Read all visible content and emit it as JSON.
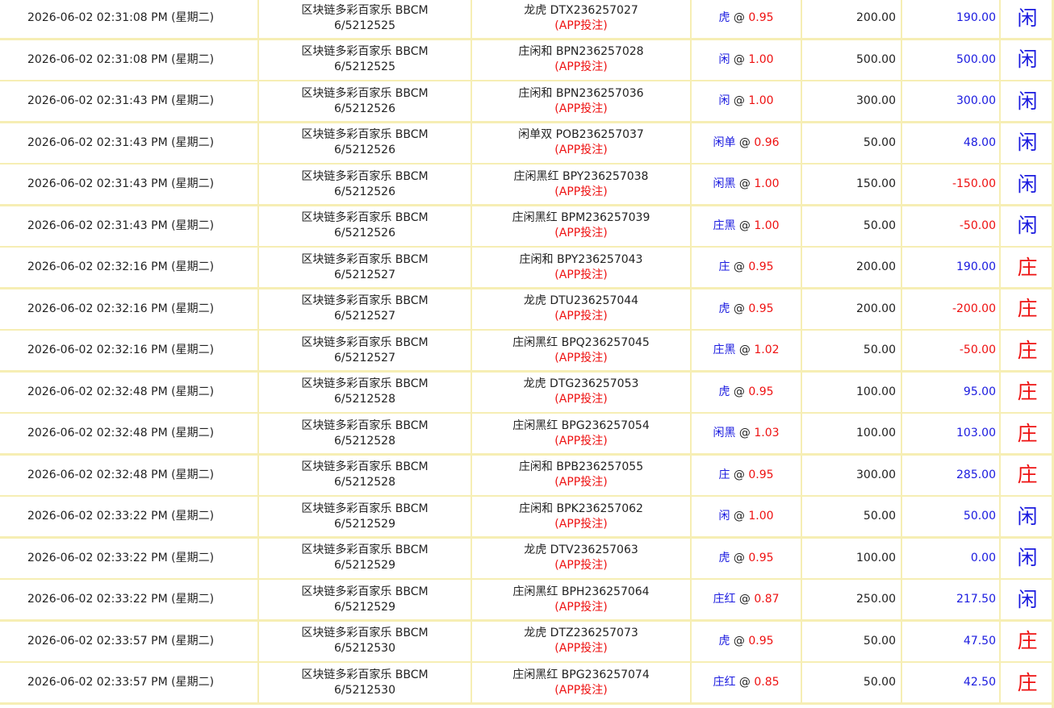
{
  "rows": [
    {
      "time": "2026-06-02 02:31:08 PM (星期二)",
      "game": "区块链多彩百家乐 BBCM",
      "round": "6/5212525",
      "bet_type": "龙虎 DTX236257027",
      "source": "(APP投注)",
      "pick": "虎",
      "odds": "0.95",
      "amount": "200.00",
      "win": "190.00",
      "win_color": "blue",
      "result": "闲",
      "result_color": "blue"
    },
    {
      "time": "2026-06-02 02:31:08 PM (星期二)",
      "game": "区块链多彩百家乐 BBCM",
      "round": "6/5212525",
      "bet_type": "庄闲和 BPN236257028",
      "source": "(APP投注)",
      "pick": "闲",
      "odds": "1.00",
      "amount": "500.00",
      "win": "500.00",
      "win_color": "blue",
      "result": "闲",
      "result_color": "blue"
    },
    {
      "time": "2026-06-02 02:31:43 PM (星期二)",
      "game": "区块链多彩百家乐 BBCM",
      "round": "6/5212526",
      "bet_type": "庄闲和 BPN236257036",
      "source": "(APP投注)",
      "pick": "闲",
      "odds": "1.00",
      "amount": "300.00",
      "win": "300.00",
      "win_color": "blue",
      "result": "闲",
      "result_color": "blue"
    },
    {
      "time": "2026-06-02 02:31:43 PM (星期二)",
      "game": "区块链多彩百家乐 BBCM",
      "round": "6/5212526",
      "bet_type": "闲单双 POB236257037",
      "source": "(APP投注)",
      "pick": "闲单",
      "odds": "0.96",
      "amount": "50.00",
      "win": "48.00",
      "win_color": "blue",
      "result": "闲",
      "result_color": "blue"
    },
    {
      "time": "2026-06-02 02:31:43 PM (星期二)",
      "game": "区块链多彩百家乐 BBCM",
      "round": "6/5212526",
      "bet_type": "庄闲黑红 BPY236257038",
      "source": "(APP投注)",
      "pick": "闲黑",
      "odds": "1.00",
      "amount": "150.00",
      "win": "-150.00",
      "win_color": "red",
      "result": "闲",
      "result_color": "blue"
    },
    {
      "time": "2026-06-02 02:31:43 PM (星期二)",
      "game": "区块链多彩百家乐 BBCM",
      "round": "6/5212526",
      "bet_type": "庄闲黑红 BPM236257039",
      "source": "(APP投注)",
      "pick": "庄黑",
      "odds": "1.00",
      "amount": "50.00",
      "win": "-50.00",
      "win_color": "red",
      "result": "闲",
      "result_color": "blue"
    },
    {
      "time": "2026-06-02 02:32:16 PM (星期二)",
      "game": "区块链多彩百家乐 BBCM",
      "round": "6/5212527",
      "bet_type": "庄闲和 BPY236257043",
      "source": "(APP投注)",
      "pick": "庄",
      "odds": "0.95",
      "amount": "200.00",
      "win": "190.00",
      "win_color": "blue",
      "result": "庄",
      "result_color": "red"
    },
    {
      "time": "2026-06-02 02:32:16 PM (星期二)",
      "game": "区块链多彩百家乐 BBCM",
      "round": "6/5212527",
      "bet_type": "龙虎 DTU236257044",
      "source": "(APP投注)",
      "pick": "虎",
      "odds": "0.95",
      "amount": "200.00",
      "win": "-200.00",
      "win_color": "red",
      "result": "庄",
      "result_color": "red"
    },
    {
      "time": "2026-06-02 02:32:16 PM (星期二)",
      "game": "区块链多彩百家乐 BBCM",
      "round": "6/5212527",
      "bet_type": "庄闲黑红 BPQ236257045",
      "source": "(APP投注)",
      "pick": "庄黑",
      "odds": "1.02",
      "amount": "50.00",
      "win": "-50.00",
      "win_color": "red",
      "result": "庄",
      "result_color": "red"
    },
    {
      "time": "2026-06-02 02:32:48 PM (星期二)",
      "game": "区块链多彩百家乐 BBCM",
      "round": "6/5212528",
      "bet_type": "龙虎 DTG236257053",
      "source": "(APP投注)",
      "pick": "虎",
      "odds": "0.95",
      "amount": "100.00",
      "win": "95.00",
      "win_color": "blue",
      "result": "庄",
      "result_color": "red"
    },
    {
      "time": "2026-06-02 02:32:48 PM (星期二)",
      "game": "区块链多彩百家乐 BBCM",
      "round": "6/5212528",
      "bet_type": "庄闲黑红 BPG236257054",
      "source": "(APP投注)",
      "pick": "闲黑",
      "odds": "1.03",
      "amount": "100.00",
      "win": "103.00",
      "win_color": "blue",
      "result": "庄",
      "result_color": "red"
    },
    {
      "time": "2026-06-02 02:32:48 PM (星期二)",
      "game": "区块链多彩百家乐 BBCM",
      "round": "6/5212528",
      "bet_type": "庄闲和 BPB236257055",
      "source": "(APP投注)",
      "pick": "庄",
      "odds": "0.95",
      "amount": "300.00",
      "win": "285.00",
      "win_color": "blue",
      "result": "庄",
      "result_color": "red"
    },
    {
      "time": "2026-06-02 02:33:22 PM (星期二)",
      "game": "区块链多彩百家乐 BBCM",
      "round": "6/5212529",
      "bet_type": "庄闲和 BPK236257062",
      "source": "(APP投注)",
      "pick": "闲",
      "odds": "1.00",
      "amount": "50.00",
      "win": "50.00",
      "win_color": "blue",
      "result": "闲",
      "result_color": "blue"
    },
    {
      "time": "2026-06-02 02:33:22 PM (星期二)",
      "game": "区块链多彩百家乐 BBCM",
      "round": "6/5212529",
      "bet_type": "龙虎 DTV236257063",
      "source": "(APP投注)",
      "pick": "虎",
      "odds": "0.95",
      "amount": "100.00",
      "win": "0.00",
      "win_color": "blue",
      "result": "闲",
      "result_color": "blue"
    },
    {
      "time": "2026-06-02 02:33:22 PM (星期二)",
      "game": "区块链多彩百家乐 BBCM",
      "round": "6/5212529",
      "bet_type": "庄闲黑红 BPH236257064",
      "source": "(APP投注)",
      "pick": "庄红",
      "odds": "0.87",
      "amount": "250.00",
      "win": "217.50",
      "win_color": "blue",
      "result": "闲",
      "result_color": "blue"
    },
    {
      "time": "2026-06-02 02:33:57 PM (星期二)",
      "game": "区块链多彩百家乐 BBCM",
      "round": "6/5212530",
      "bet_type": "龙虎 DTZ236257073",
      "source": "(APP投注)",
      "pick": "虎",
      "odds": "0.95",
      "amount": "50.00",
      "win": "47.50",
      "win_color": "blue",
      "result": "庄",
      "result_color": "red"
    },
    {
      "time": "2026-06-02 02:33:57 PM (星期二)",
      "game": "区块链多彩百家乐 BBCM",
      "round": "6/5212530",
      "bet_type": "庄闲黑红 BPG236257074",
      "source": "(APP投注)",
      "pick": "庄红",
      "odds": "0.85",
      "amount": "50.00",
      "win": "42.50",
      "win_color": "blue",
      "result": "庄",
      "result_color": "red"
    }
  ],
  "colors": {
    "grid_line": "#f6eeb4",
    "red": "#ee1111",
    "blue": "#1a1adf",
    "text": "#222222"
  }
}
